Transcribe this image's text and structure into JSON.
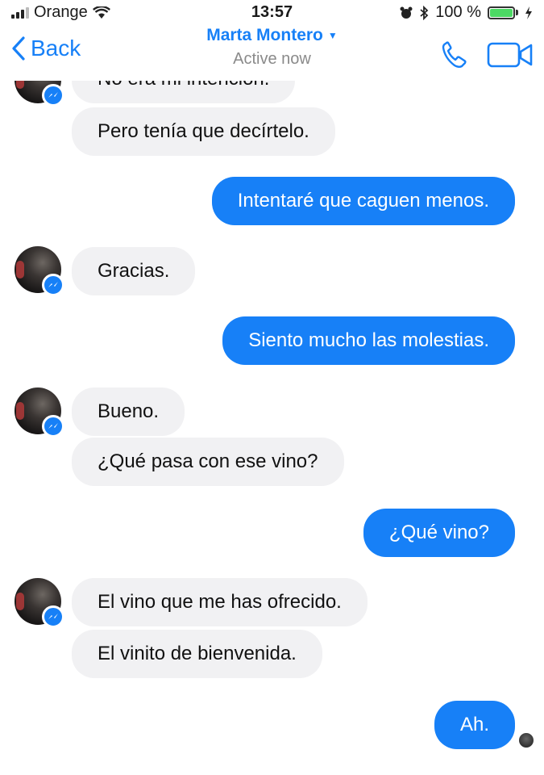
{
  "status_bar": {
    "carrier": "Orange",
    "time": "13:57",
    "battery": "100 %"
  },
  "header": {
    "back_label": "Back",
    "contact_name": "Marta Montero",
    "presence": "Active now"
  },
  "messages": [
    {
      "side": "in",
      "text": "No era mi intención."
    },
    {
      "side": "in",
      "text": "Pero tenía que decírtelo."
    },
    {
      "side": "out",
      "text": "Intentaré que caguen menos."
    },
    {
      "side": "in",
      "text": "Gracias."
    },
    {
      "side": "out",
      "text": "Siento mucho las molestias."
    },
    {
      "side": "in",
      "text": "Bueno."
    },
    {
      "side": "in",
      "text": "¿Qué pasa con ese vino?"
    },
    {
      "side": "out",
      "text": "¿Qué vino?"
    },
    {
      "side": "in",
      "text": "El vino que me has ofrecido."
    },
    {
      "side": "in",
      "text": "El vinito de bienvenida."
    },
    {
      "side": "out",
      "text": "Ah."
    }
  ],
  "colors": {
    "accent": "#1780f7",
    "incoming_bubble": "#f1f1f3",
    "presence_text": "#8a8a8a"
  },
  "icons": [
    "signal-icon",
    "wifi-icon",
    "alarm-icon",
    "bluetooth-icon",
    "battery-icon",
    "charging-icon",
    "back-chevron-icon",
    "dropdown-caret-icon",
    "phone-icon",
    "video-camera-icon",
    "messenger-badge-icon"
  ]
}
